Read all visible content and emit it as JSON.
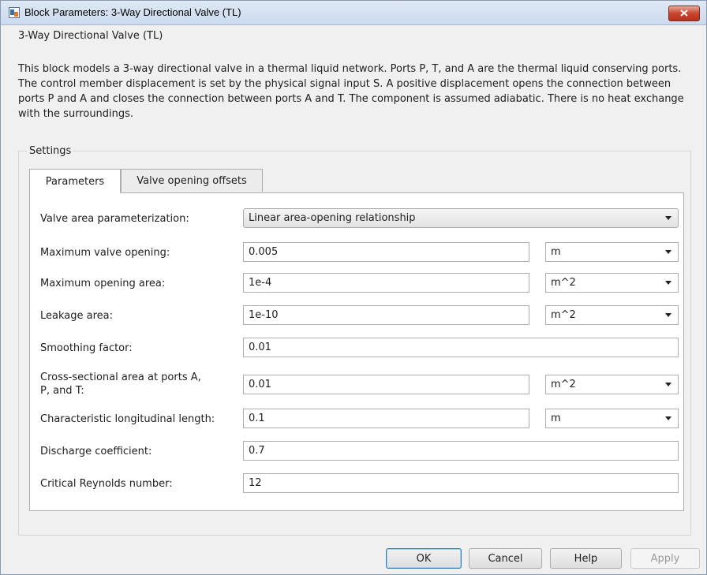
{
  "window": {
    "title": "Block Parameters: 3-Way Directional Valve (TL)",
    "close_label": "x"
  },
  "block": {
    "name": "3-Way Directional Valve (TL)",
    "description": "This block models a 3-way directional valve in a thermal liquid network. Ports P, T, and A are the thermal liquid conserving ports. The control member displacement is set by the physical signal input S. A positive displacement opens the connection between ports P and A and closes the connection between ports A and T. The component is assumed adiabatic. There is no heat exchange with the surroundings."
  },
  "settings": {
    "legend": "Settings",
    "tabs": [
      {
        "label": "Parameters",
        "active": true
      },
      {
        "label": "Valve opening offsets",
        "active": false
      }
    ],
    "params": {
      "area_param": {
        "label": "Valve area parameterization:",
        "value": "Linear area-opening relationship"
      },
      "max_opening": {
        "label": "Maximum valve opening:",
        "value": "0.005",
        "unit": "m"
      },
      "max_area": {
        "label": "Maximum opening area:",
        "value": "1e-4",
        "unit": "m^2"
      },
      "leak_area": {
        "label": "Leakage area:",
        "value": "1e-10",
        "unit": "m^2"
      },
      "smoothing": {
        "label": "Smoothing factor:",
        "value": "0.01"
      },
      "cross_area": {
        "label_line1": "Cross-sectional area at ports A,",
        "label_line2": "P, and T:",
        "value": "0.01",
        "unit": "m^2"
      },
      "char_length": {
        "label": "Characteristic longitudinal length:",
        "value": "0.1",
        "unit": "m"
      },
      "discharge": {
        "label": "Discharge coefficient:",
        "value": "0.7"
      },
      "reynolds": {
        "label": "Critical Reynolds number:",
        "value": "12"
      }
    }
  },
  "buttons": {
    "ok": "OK",
    "cancel": "Cancel",
    "help": "Help",
    "apply": "Apply"
  },
  "colors": {
    "close_button": "#c8452f",
    "ok_border": "#3c7fb1"
  }
}
